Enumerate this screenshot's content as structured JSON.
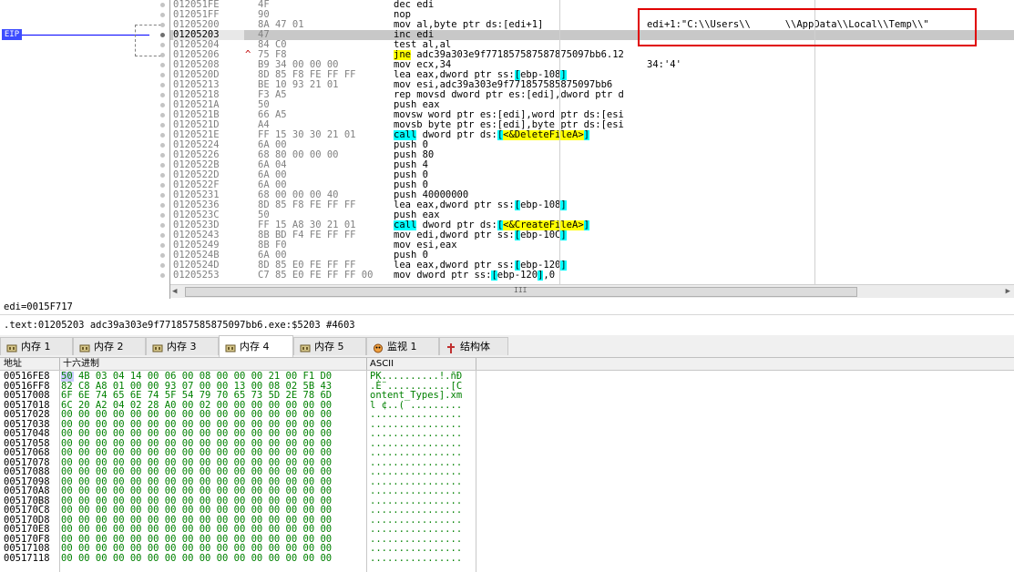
{
  "eip_label": "EIP",
  "current_address": "01205203",
  "rows": [
    {
      "addr": "012051FE",
      "hex": "4F",
      "mark": "",
      "asm": [
        [
          "t",
          "dec edi"
        ]
      ],
      "cmt": ""
    },
    {
      "addr": "012051FF",
      "hex": "90",
      "mark": "",
      "asm": [
        [
          "t",
          "nop"
        ]
      ],
      "cmt": ""
    },
    {
      "addr": "01205200",
      "hex": "8A 47 01",
      "mark": "",
      "asm": [
        [
          "t",
          "mov al,byte ptr ds:[edi+1]"
        ]
      ],
      "cmt": "edi+1:\"C:\\\\Users\\\\      \\\\AppData\\\\Local\\\\Temp\\\\\""
    },
    {
      "addr": "01205203",
      "hex": "47",
      "mark": "",
      "asm": [
        [
          "t",
          "inc edi"
        ]
      ],
      "cmt": "",
      "sel": true
    },
    {
      "addr": "01205204",
      "hex": "84 C0",
      "mark": "",
      "asm": [
        [
          "t",
          "test al,al"
        ]
      ],
      "cmt": ""
    },
    {
      "addr": "01205206",
      "hex": "75 F8",
      "mark": "^",
      "asm": [
        [
          "j",
          "jne"
        ],
        [
          "t",
          " adc39a303e9f77185758758787509​7bb6.12"
        ]
      ],
      "cmt": ""
    },
    {
      "addr": "01205208",
      "hex": "B9 34 00 00 00",
      "mark": "",
      "asm": [
        [
          "t",
          "mov ecx,34"
        ]
      ],
      "cmt": "34:'4'"
    },
    {
      "addr": "0120520D",
      "hex": "8D 85 F8 FE FF FF",
      "mark": "",
      "asm": [
        [
          "t",
          "lea eax,dword ptr ss:"
        ],
        [
          "c",
          "["
        ],
        [
          "t",
          "ebp-108"
        ],
        [
          "c",
          "]"
        ]
      ],
      "cmt": ""
    },
    {
      "addr": "01205213",
      "hex": "BE 10 93 21 01",
      "mark": "",
      "asm": [
        [
          "t",
          "mov esi,adc39a303e9f771857585875097bb6"
        ]
      ],
      "cmt": ""
    },
    {
      "addr": "01205218",
      "hex": "F3 A5",
      "mark": "",
      "asm": [
        [
          "t",
          "rep movsd dword ptr es:[edi],dword ptr d"
        ]
      ],
      "cmt": ""
    },
    {
      "addr": "0120521A",
      "hex": "50",
      "mark": "",
      "asm": [
        [
          "t",
          "push eax"
        ]
      ],
      "cmt": ""
    },
    {
      "addr": "0120521B",
      "hex": "66 A5",
      "mark": "",
      "asm": [
        [
          "t",
          "movsw word ptr es:[edi],word ptr ds:[esi"
        ]
      ],
      "cmt": ""
    },
    {
      "addr": "0120521D",
      "hex": "A4",
      "mark": "",
      "asm": [
        [
          "t",
          "movsb byte ptr es:[edi],byte ptr ds:[esi"
        ]
      ],
      "cmt": ""
    },
    {
      "addr": "0120521E",
      "hex": "FF 15 30 30 21 01",
      "mark": "",
      "asm": [
        [
          "k",
          "call"
        ],
        [
          "t",
          " dword ptr ds:"
        ],
        [
          "c",
          "["
        ],
        [
          "y",
          "<&DeleteFileA>"
        ],
        [
          "c",
          "]"
        ]
      ],
      "cmt": ""
    },
    {
      "addr": "01205224",
      "hex": "6A 00",
      "mark": "",
      "asm": [
        [
          "t",
          "push 0"
        ]
      ],
      "cmt": ""
    },
    {
      "addr": "01205226",
      "hex": "68 80 00 00 00",
      "mark": "",
      "asm": [
        [
          "t",
          "push 80"
        ]
      ],
      "cmt": ""
    },
    {
      "addr": "0120522B",
      "hex": "6A 04",
      "mark": "",
      "asm": [
        [
          "t",
          "push 4"
        ]
      ],
      "cmt": ""
    },
    {
      "addr": "0120522D",
      "hex": "6A 00",
      "mark": "",
      "asm": [
        [
          "t",
          "push 0"
        ]
      ],
      "cmt": ""
    },
    {
      "addr": "0120522F",
      "hex": "6A 00",
      "mark": "",
      "asm": [
        [
          "t",
          "push 0"
        ]
      ],
      "cmt": ""
    },
    {
      "addr": "01205231",
      "hex": "68 00 00 00 40",
      "mark": "",
      "asm": [
        [
          "t",
          "push 40000000"
        ]
      ],
      "cmt": ""
    },
    {
      "addr": "01205236",
      "hex": "8D 85 F8 FE FF FF",
      "mark": "",
      "asm": [
        [
          "t",
          "lea eax,dword ptr ss:"
        ],
        [
          "c",
          "["
        ],
        [
          "t",
          "ebp-108"
        ],
        [
          "c",
          "]"
        ]
      ],
      "cmt": ""
    },
    {
      "addr": "0120523C",
      "hex": "50",
      "mark": "",
      "asm": [
        [
          "t",
          "push eax"
        ]
      ],
      "cmt": ""
    },
    {
      "addr": "0120523D",
      "hex": "FF 15 A8 30 21 01",
      "mark": "",
      "asm": [
        [
          "k",
          "call"
        ],
        [
          "t",
          " dword ptr ds:"
        ],
        [
          "c",
          "["
        ],
        [
          "y",
          "<&CreateFileA>"
        ],
        [
          "c",
          "]"
        ]
      ],
      "cmt": ""
    },
    {
      "addr": "01205243",
      "hex": "8B BD F4 FE FF FF",
      "mark": "",
      "asm": [
        [
          "t",
          "mov edi,dword ptr ss:"
        ],
        [
          "c",
          "["
        ],
        [
          "t",
          "ebp-10C"
        ],
        [
          "c",
          "]"
        ]
      ],
      "cmt": ""
    },
    {
      "addr": "01205249",
      "hex": "8B F0",
      "mark": "",
      "asm": [
        [
          "t",
          "mov esi,eax"
        ]
      ],
      "cmt": ""
    },
    {
      "addr": "0120524B",
      "hex": "6A 00",
      "mark": "",
      "asm": [
        [
          "t",
          "push 0"
        ]
      ],
      "cmt": ""
    },
    {
      "addr": "0120524D",
      "hex": "8D 85 E0 FE FF FF",
      "mark": "",
      "asm": [
        [
          "t",
          "lea eax,dword ptr ss:"
        ],
        [
          "c",
          "["
        ],
        [
          "t",
          "ebp-120"
        ],
        [
          "c",
          "]"
        ]
      ],
      "cmt": ""
    },
    {
      "addr": "01205253",
      "hex": "C7 85 E0 FE FF FF 00",
      "mark": "",
      "asm": [
        [
          "t",
          "mov dword ptr ss:"
        ],
        [
          "c",
          "["
        ],
        [
          "t",
          "ebp-120"
        ],
        [
          "c",
          "]"
        ],
        [
          "t",
          ",0"
        ]
      ],
      "cmt": ""
    }
  ],
  "info_line1": "edi=0015F717",
  "info_line2": ".text:01205203 adc39a303e9f771857585875097bb6.exe:$5203 #4603",
  "tabs": [
    {
      "label": "内存 1",
      "icon": "memory-icon"
    },
    {
      "label": "内存 2",
      "icon": "memory-icon"
    },
    {
      "label": "内存 3",
      "icon": "memory-icon"
    },
    {
      "label": "内存 4",
      "icon": "memory-icon",
      "active": true
    },
    {
      "label": "内存 5",
      "icon": "memory-icon"
    },
    {
      "label": "监视 1",
      "icon": "watch-icon"
    },
    {
      "label": "结构体",
      "icon": "struct-icon"
    }
  ],
  "dump_headers": {
    "addr": "地址",
    "hex": "十六进制",
    "ascii": "ASCII"
  },
  "dump_rows": [
    {
      "addr": "00516FE8",
      "hex": "50 4B 03 04 14 00 06 00 08 00 00 00 21 00 F1 D0",
      "ascii": "PK..........!.ñÐ"
    },
    {
      "addr": "00516FF8",
      "hex": "82 C8 A8 01 00 00 93 07 00 00 13 00 08 02 5B 43",
      "ascii": ".È¨...........[C"
    },
    {
      "addr": "00517008",
      "hex": "6F 6E 74 65 6E 74 5F 54 79 70 65 73 5D 2E 78 6D",
      "ascii": "ontent_Types].xm"
    },
    {
      "addr": "00517018",
      "hex": "6C 20 A2 04 02 28 A0 00 02 00 00 00 00 00 00 00",
      "ascii": "l ¢..( ........."
    },
    {
      "addr": "00517028",
      "hex": "00 00 00 00 00 00 00 00 00 00 00 00 00 00 00 00",
      "ascii": "................"
    },
    {
      "addr": "00517038",
      "hex": "00 00 00 00 00 00 00 00 00 00 00 00 00 00 00 00",
      "ascii": "................"
    },
    {
      "addr": "00517048",
      "hex": "00 00 00 00 00 00 00 00 00 00 00 00 00 00 00 00",
      "ascii": "................"
    },
    {
      "addr": "00517058",
      "hex": "00 00 00 00 00 00 00 00 00 00 00 00 00 00 00 00",
      "ascii": "................"
    },
    {
      "addr": "00517068",
      "hex": "00 00 00 00 00 00 00 00 00 00 00 00 00 00 00 00",
      "ascii": "................"
    },
    {
      "addr": "00517078",
      "hex": "00 00 00 00 00 00 00 00 00 00 00 00 00 00 00 00",
      "ascii": "................"
    },
    {
      "addr": "00517088",
      "hex": "00 00 00 00 00 00 00 00 00 00 00 00 00 00 00 00",
      "ascii": "................"
    },
    {
      "addr": "00517098",
      "hex": "00 00 00 00 00 00 00 00 00 00 00 00 00 00 00 00",
      "ascii": "................"
    },
    {
      "addr": "005170A8",
      "hex": "00 00 00 00 00 00 00 00 00 00 00 00 00 00 00 00",
      "ascii": "................"
    },
    {
      "addr": "005170B8",
      "hex": "00 00 00 00 00 00 00 00 00 00 00 00 00 00 00 00",
      "ascii": "................"
    },
    {
      "addr": "005170C8",
      "hex": "00 00 00 00 00 00 00 00 00 00 00 00 00 00 00 00",
      "ascii": "................"
    },
    {
      "addr": "005170D8",
      "hex": "00 00 00 00 00 00 00 00 00 00 00 00 00 00 00 00",
      "ascii": "................"
    },
    {
      "addr": "005170E8",
      "hex": "00 00 00 00 00 00 00 00 00 00 00 00 00 00 00 00",
      "ascii": "................"
    },
    {
      "addr": "005170F8",
      "hex": "00 00 00 00 00 00 00 00 00 00 00 00 00 00 00 00",
      "ascii": "................"
    },
    {
      "addr": "00517108",
      "hex": "00 00 00 00 00 00 00 00 00 00 00 00 00 00 00 00",
      "ascii": "................"
    },
    {
      "addr": "00517118",
      "hex": "00 00 00 00 00 00 00 00 00 00 00 00 00 00 00 00",
      "ascii": "................"
    }
  ],
  "scroll_marker": "III",
  "colors": {
    "eip_bg": "#3c4cff",
    "selected_row": "#c8c8c8",
    "bracket_cyan": "#00ffff",
    "label_yellow": "#ffff00",
    "highlight_box": "#e00000"
  }
}
